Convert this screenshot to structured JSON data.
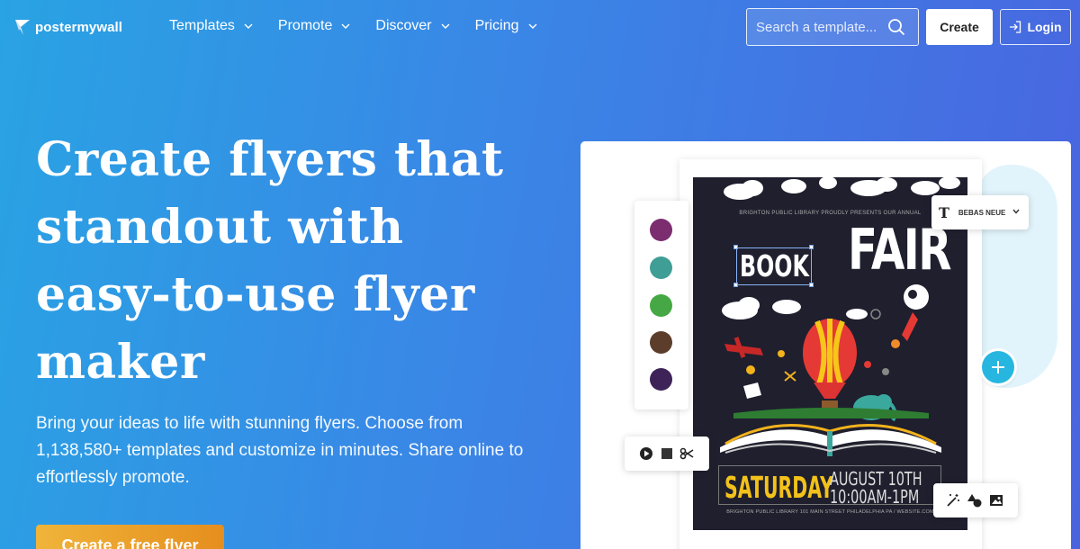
{
  "brand": {
    "name": "postermywall"
  },
  "nav": {
    "items": [
      {
        "label": "Templates"
      },
      {
        "label": "Promote"
      },
      {
        "label": "Discover"
      },
      {
        "label": "Pricing"
      }
    ]
  },
  "search": {
    "placeholder": "Search a template..."
  },
  "header_buttons": {
    "create": "Create",
    "login": "Login"
  },
  "hero": {
    "title": "Create flyers that standout with easy-to-use flyer maker",
    "subtitle": "Bring your ideas to life with stunning flyers. Choose from 1,138,580+ templates and customize in minutes. Share online to effortlessly promote.",
    "cta": "Create a free flyer"
  },
  "editor": {
    "swatches": [
      "#7b2d6f",
      "#3f9e96",
      "#45a844",
      "#5c3d2c",
      "#3e2358"
    ],
    "font_picker": {
      "icon": "T",
      "font_name": "BEBAS NEUE"
    },
    "poster": {
      "top_line": "BRIGHTON PUBLIC LIBRARY PROUDLY PRESENTS OUR ANNUAL",
      "word_book": "BOOK",
      "word_fair": "FAIR",
      "day": "SATURDAY",
      "date": "AUGUST 10TH",
      "time": "10:00AM-1PM",
      "address": "BRIGHTON PUBLIC LIBRARY 101 MAIN STREET PHILADELPHIA PA / WEBSITE.COM"
    },
    "icons": {
      "media": [
        "play-icon",
        "stop-icon",
        "scissors-icon"
      ],
      "tools": [
        "magic-wand-icon",
        "shapes-icon",
        "image-icon"
      ],
      "add": "plus-icon"
    }
  }
}
